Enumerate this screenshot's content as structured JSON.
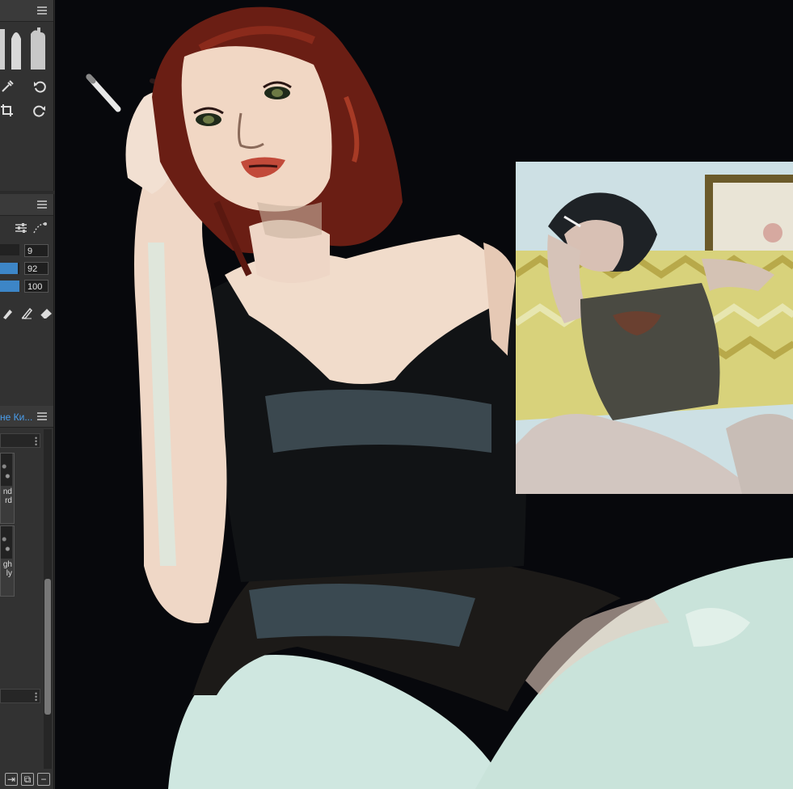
{
  "brush_settings": {
    "size_value": "9",
    "opacity_value": "92",
    "flow_value": "100",
    "opacity_fraction": 0.92,
    "flow_fraction": 1.0
  },
  "brush_presets": {
    "tab_label": "не Ки...",
    "preset_1_label": "nd\nrd",
    "preset_2_label": "gh\nly"
  },
  "colors": {
    "accent": "#3d86c7",
    "link": "#4a9eed",
    "canvas_bg": "#07080c"
  }
}
